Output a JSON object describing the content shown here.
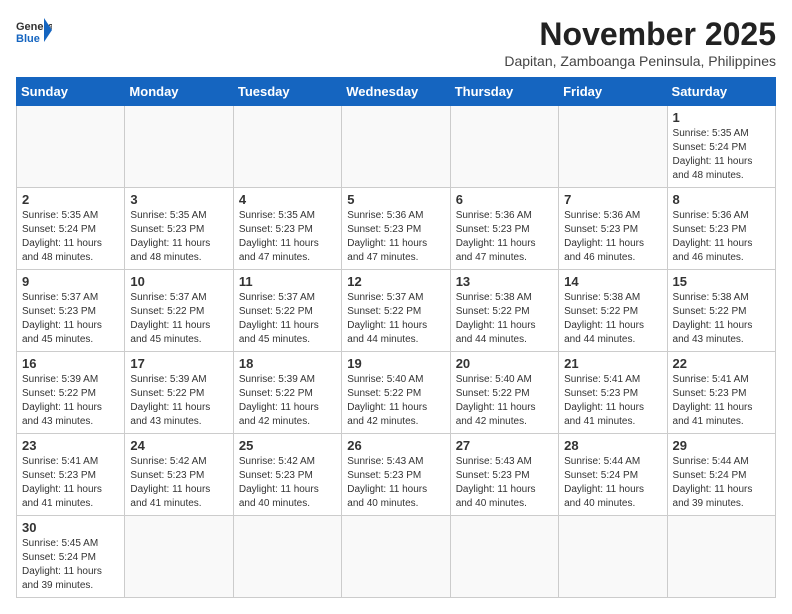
{
  "logo": {
    "general": "General",
    "blue": "Blue"
  },
  "header": {
    "month_year": "November 2025",
    "location": "Dapitan, Zamboanga Peninsula, Philippines"
  },
  "weekdays": [
    "Sunday",
    "Monday",
    "Tuesday",
    "Wednesday",
    "Thursday",
    "Friday",
    "Saturday"
  ],
  "weeks": [
    [
      {
        "day": "",
        "text": ""
      },
      {
        "day": "",
        "text": ""
      },
      {
        "day": "",
        "text": ""
      },
      {
        "day": "",
        "text": ""
      },
      {
        "day": "",
        "text": ""
      },
      {
        "day": "",
        "text": ""
      },
      {
        "day": "1",
        "text": "Sunrise: 5:35 AM\nSunset: 5:24 PM\nDaylight: 11 hours and 48 minutes."
      }
    ],
    [
      {
        "day": "2",
        "text": "Sunrise: 5:35 AM\nSunset: 5:24 PM\nDaylight: 11 hours and 48 minutes."
      },
      {
        "day": "3",
        "text": "Sunrise: 5:35 AM\nSunset: 5:23 PM\nDaylight: 11 hours and 48 minutes."
      },
      {
        "day": "4",
        "text": "Sunrise: 5:35 AM\nSunset: 5:23 PM\nDaylight: 11 hours and 47 minutes."
      },
      {
        "day": "5",
        "text": "Sunrise: 5:36 AM\nSunset: 5:23 PM\nDaylight: 11 hours and 47 minutes."
      },
      {
        "day": "6",
        "text": "Sunrise: 5:36 AM\nSunset: 5:23 PM\nDaylight: 11 hours and 47 minutes."
      },
      {
        "day": "7",
        "text": "Sunrise: 5:36 AM\nSunset: 5:23 PM\nDaylight: 11 hours and 46 minutes."
      },
      {
        "day": "8",
        "text": "Sunrise: 5:36 AM\nSunset: 5:23 PM\nDaylight: 11 hours and 46 minutes."
      }
    ],
    [
      {
        "day": "9",
        "text": "Sunrise: 5:37 AM\nSunset: 5:23 PM\nDaylight: 11 hours and 45 minutes."
      },
      {
        "day": "10",
        "text": "Sunrise: 5:37 AM\nSunset: 5:22 PM\nDaylight: 11 hours and 45 minutes."
      },
      {
        "day": "11",
        "text": "Sunrise: 5:37 AM\nSunset: 5:22 PM\nDaylight: 11 hours and 45 minutes."
      },
      {
        "day": "12",
        "text": "Sunrise: 5:37 AM\nSunset: 5:22 PM\nDaylight: 11 hours and 44 minutes."
      },
      {
        "day": "13",
        "text": "Sunrise: 5:38 AM\nSunset: 5:22 PM\nDaylight: 11 hours and 44 minutes."
      },
      {
        "day": "14",
        "text": "Sunrise: 5:38 AM\nSunset: 5:22 PM\nDaylight: 11 hours and 44 minutes."
      },
      {
        "day": "15",
        "text": "Sunrise: 5:38 AM\nSunset: 5:22 PM\nDaylight: 11 hours and 43 minutes."
      }
    ],
    [
      {
        "day": "16",
        "text": "Sunrise: 5:39 AM\nSunset: 5:22 PM\nDaylight: 11 hours and 43 minutes."
      },
      {
        "day": "17",
        "text": "Sunrise: 5:39 AM\nSunset: 5:22 PM\nDaylight: 11 hours and 43 minutes."
      },
      {
        "day": "18",
        "text": "Sunrise: 5:39 AM\nSunset: 5:22 PM\nDaylight: 11 hours and 42 minutes."
      },
      {
        "day": "19",
        "text": "Sunrise: 5:40 AM\nSunset: 5:22 PM\nDaylight: 11 hours and 42 minutes."
      },
      {
        "day": "20",
        "text": "Sunrise: 5:40 AM\nSunset: 5:22 PM\nDaylight: 11 hours and 42 minutes."
      },
      {
        "day": "21",
        "text": "Sunrise: 5:41 AM\nSunset: 5:23 PM\nDaylight: 11 hours and 41 minutes."
      },
      {
        "day": "22",
        "text": "Sunrise: 5:41 AM\nSunset: 5:23 PM\nDaylight: 11 hours and 41 minutes."
      }
    ],
    [
      {
        "day": "23",
        "text": "Sunrise: 5:41 AM\nSunset: 5:23 PM\nDaylight: 11 hours and 41 minutes."
      },
      {
        "day": "24",
        "text": "Sunrise: 5:42 AM\nSunset: 5:23 PM\nDaylight: 11 hours and 41 minutes."
      },
      {
        "day": "25",
        "text": "Sunrise: 5:42 AM\nSunset: 5:23 PM\nDaylight: 11 hours and 40 minutes."
      },
      {
        "day": "26",
        "text": "Sunrise: 5:43 AM\nSunset: 5:23 PM\nDaylight: 11 hours and 40 minutes."
      },
      {
        "day": "27",
        "text": "Sunrise: 5:43 AM\nSunset: 5:23 PM\nDaylight: 11 hours and 40 minutes."
      },
      {
        "day": "28",
        "text": "Sunrise: 5:44 AM\nSunset: 5:24 PM\nDaylight: 11 hours and 40 minutes."
      },
      {
        "day": "29",
        "text": "Sunrise: 5:44 AM\nSunset: 5:24 PM\nDaylight: 11 hours and 39 minutes."
      }
    ],
    [
      {
        "day": "30",
        "text": "Sunrise: 5:45 AM\nSunset: 5:24 PM\nDaylight: 11 hours and 39 minutes."
      },
      {
        "day": "",
        "text": ""
      },
      {
        "day": "",
        "text": ""
      },
      {
        "day": "",
        "text": ""
      },
      {
        "day": "",
        "text": ""
      },
      {
        "day": "",
        "text": ""
      },
      {
        "day": "",
        "text": ""
      }
    ]
  ]
}
